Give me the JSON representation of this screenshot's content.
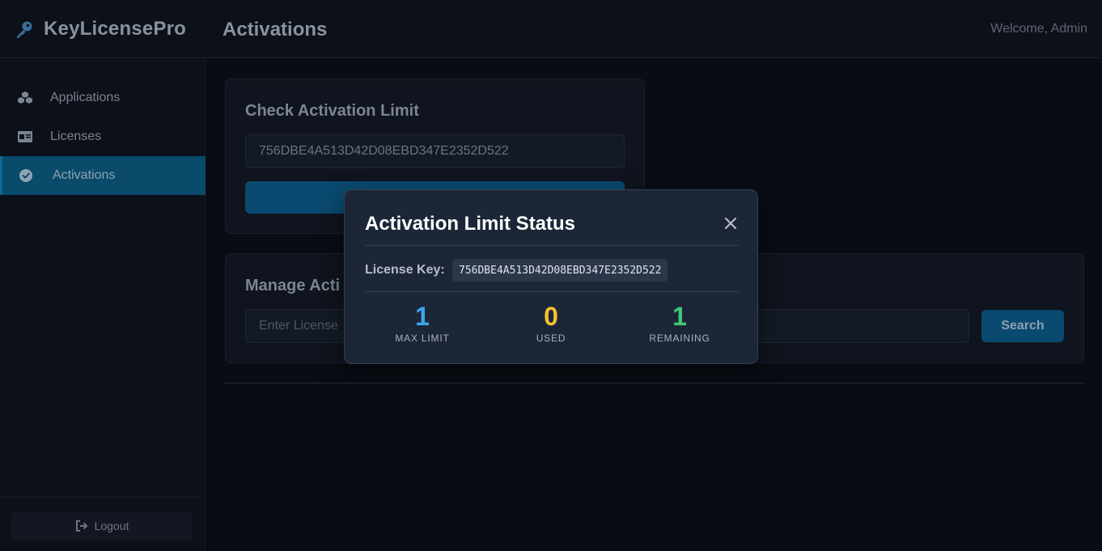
{
  "header": {
    "brand": "KeyLicensePro",
    "brand_icon": "key-icon",
    "page_title": "Activations",
    "welcome": "Welcome, Admin"
  },
  "sidebar": {
    "items": [
      {
        "label": "Applications",
        "icon": "cubes-icon",
        "active": false
      },
      {
        "label": "Licenses",
        "icon": "id-card-icon",
        "active": false
      },
      {
        "label": "Activations",
        "icon": "check-circle-icon",
        "active": true
      }
    ],
    "logout_label": "Logout",
    "logout_icon": "sign-out-icon"
  },
  "check_card": {
    "title": "Check Activation Limit",
    "license_value": "756DBE4A513D42D08EBD347E2352D522"
  },
  "manage_card": {
    "title": "Manage Acti",
    "search_placeholder": "Enter License",
    "search_button": "Search"
  },
  "modal": {
    "title": "Activation Limit Status",
    "license_key_label": "License Key:",
    "license_key_value": "756DBE4A513D42D08EBD347E2352D522",
    "stats": [
      {
        "value": "1",
        "label": "MAX LIMIT",
        "color": "#38a8ef"
      },
      {
        "value": "0",
        "label": "USED",
        "color": "#f5c033"
      },
      {
        "value": "1",
        "label": "REMAINING",
        "color": "#3ec978"
      }
    ]
  },
  "colors": {
    "accent": "#0a4a6a",
    "background": "#090c14"
  }
}
